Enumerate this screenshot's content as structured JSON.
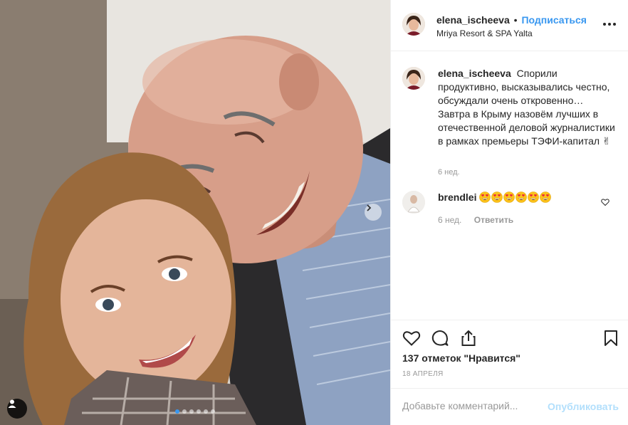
{
  "post": {
    "username": "elena_ischeeva",
    "separator": "•",
    "follow_label": "Подписаться",
    "location": "Mriya Resort & SPA Yalta"
  },
  "caption": {
    "username": "elena_ischeeva",
    "text": "Спорили продуктивно, высказывались честно, обсуждали очень откровенно… Завтра в Крыму назовём лучших в отечественной деловой журналистики в рамках премьеры ТЭФИ-капитал ✌",
    "time": "6 нед."
  },
  "comments": [
    {
      "username": "brendlei",
      "emoji_count": 6,
      "emoji": "heart-eyes-emoji",
      "time": "6 нед.",
      "reply_label": "Ответить"
    }
  ],
  "stats": {
    "likes": "137 отметок \"Нравится\"",
    "date": "18 АПРЕЛЯ"
  },
  "add_comment": {
    "placeholder": "Добавьте комментарий...",
    "publish_label": "Опубликовать"
  },
  "carousel": {
    "total_slides": 6,
    "active_index": 0
  },
  "icons": {
    "like": "heart-icon",
    "comment": "comment-bubble-icon",
    "share": "share-icon",
    "save": "bookmark-icon",
    "more": "more-options-icon",
    "next": "chevron-right-icon",
    "tag": "user-tag-icon"
  },
  "colors": {
    "accent": "#3897f0",
    "publish_disabled": "#b2dffc",
    "muted": "#999999",
    "text": "#262626"
  }
}
